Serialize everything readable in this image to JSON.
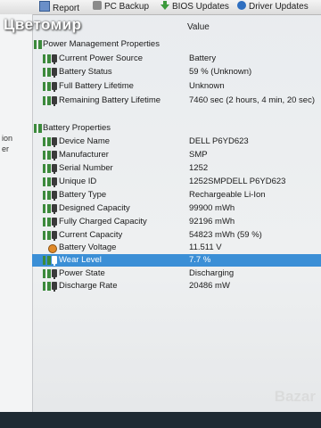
{
  "toolbar": {
    "items": [
      {
        "label": "Report",
        "icon": "report-icon"
      },
      {
        "label": "PC Backup",
        "icon": "backup-icon"
      },
      {
        "label": "BIOS Updates",
        "icon": "bios-update-icon"
      },
      {
        "label": "Driver Updates",
        "icon": "driver-update-icon"
      }
    ]
  },
  "watermark": "Цветомир",
  "bazar": "Bazar",
  "column_header": "Value",
  "side_labels": [
    "ion",
    "er"
  ],
  "sections": {
    "power": {
      "title": "Power Management Properties",
      "rows": [
        {
          "label": "Current Power Source",
          "value": "Battery"
        },
        {
          "label": "Battery Status",
          "value": "59 % (Unknown)"
        },
        {
          "label": "Full Battery Lifetime",
          "value": "Unknown"
        },
        {
          "label": "Remaining Battery Lifetime",
          "value": "7460 sec (2 hours, 4 min, 20 sec)"
        }
      ]
    },
    "battery": {
      "title": "Battery Properties",
      "rows": [
        {
          "label": "Device Name",
          "value": "DELL P6YD623"
        },
        {
          "label": "Manufacturer",
          "value": "SMP"
        },
        {
          "label": "Serial Number",
          "value": "1252"
        },
        {
          "label": "Unique ID",
          "value": "1252SMPDELL P6YD623"
        },
        {
          "label": "Battery Type",
          "value": "Rechargeable Li-Ion"
        },
        {
          "label": "Designed Capacity",
          "value": "99900 mWh"
        },
        {
          "label": "Fully Charged Capacity",
          "value": "92196 mWh"
        },
        {
          "label": "Current Capacity",
          "value": "54823 mWh (59 %)"
        },
        {
          "label": "Battery Voltage",
          "value": "11.511 V"
        },
        {
          "label": "Wear Level",
          "value": "7.7 %"
        },
        {
          "label": "Power State",
          "value": "Discharging"
        },
        {
          "label": "Discharge Rate",
          "value": "20486 mW"
        }
      ]
    }
  },
  "colors": {
    "selection": "#3b8fd6",
    "tree_icon": "#3c8a3c",
    "background": "#e9ecef"
  }
}
